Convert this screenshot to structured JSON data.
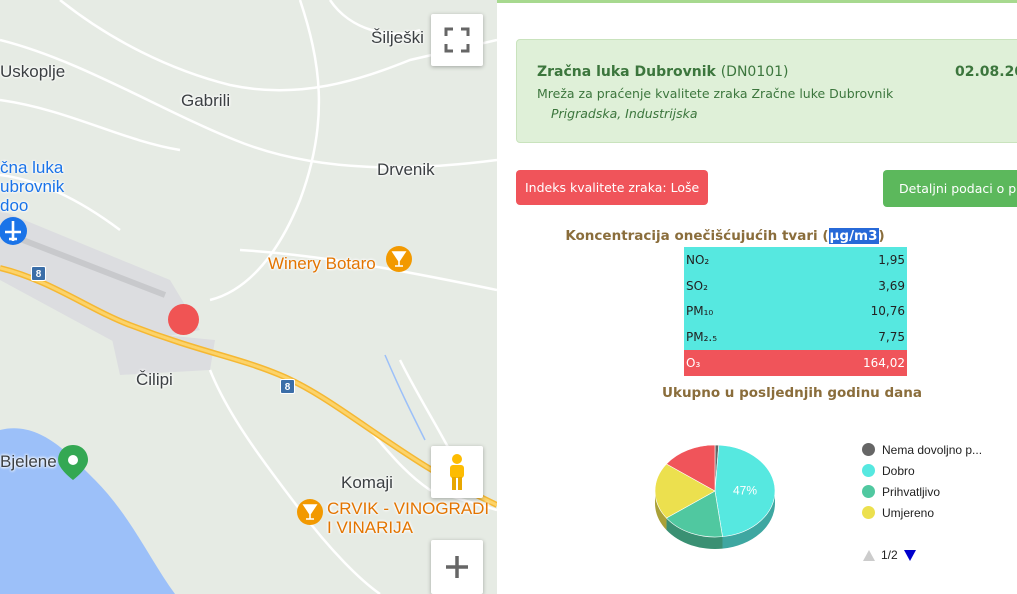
{
  "map": {
    "places": {
      "siljeski": "Šilješki",
      "uskoplje": "Uskoplje",
      "gabrili": "Gabrili",
      "airport_line1": "čna luka",
      "airport_line2": "ubrovnik",
      "airport_line3": "doo",
      "drvenik": "Drvenik",
      "winery": "Winery Botaro",
      "cilipi": "Čilipi",
      "komaji": "Komaji",
      "crvik_line1": "CRVIK - VINOGRADI",
      "crvik_line2": "I VINARIJA",
      "bjelene": "Bjelene"
    },
    "road_shields": [
      "8",
      "8"
    ],
    "icons": {
      "fullscreen": "fullscreen-icon",
      "pegman": "pegman-icon",
      "zoom_in": "plus-icon",
      "airport": "airplane-icon",
      "winery_pin": "wine-glass-icon",
      "park_pin": "location-pin-icon"
    },
    "marker_color": "#f05454"
  },
  "station": {
    "name": "Zračna luka Dubrovnik",
    "code": "(DN0101)",
    "date": "02.08.20",
    "network": "Mreža za praćenje kvalitete zraka Zračne luke Dubrovnik",
    "type": "Prigradska, Industrijska"
  },
  "aqi": {
    "label": "Indeks kvalitete zraka: Loše",
    "color": "#f0545a"
  },
  "details_button": "Detaljni podaci o p",
  "concentration": {
    "title_prefix": "Koncentracija onečišćujućih tvari (",
    "unit": "µg/m3",
    "title_suffix": ")",
    "rows": [
      {
        "name": "NO₂",
        "value": "1,95",
        "color": "#56e8e0"
      },
      {
        "name": "SO₂",
        "value": "3,69",
        "color": "#56e8e0"
      },
      {
        "name": "PM₁₀",
        "value": "10,76",
        "color": "#56e8e0"
      },
      {
        "name": "PM₂.₅",
        "value": "7,75",
        "color": "#56e8e0"
      },
      {
        "name": "O₃",
        "value": "164,02",
        "color": "#f0545a"
      }
    ]
  },
  "year_summary": {
    "title": "Ukupno u posljednjih godinu dana",
    "slice_label": "47%",
    "legend": [
      {
        "label": "Nema dovoljno p...",
        "color": "#666666"
      },
      {
        "label": "Dobro",
        "color": "#56e8e0"
      },
      {
        "label": "Prihvatljivo",
        "color": "#50c8a0"
      },
      {
        "label": "Umjereno",
        "color": "#ece04e"
      }
    ],
    "pager": "1/2"
  },
  "chart_data": {
    "type": "pie",
    "categories": [
      "Nema dovoljno podataka",
      "Dobro",
      "Prihvatljivo",
      "Umjereno",
      "Loše"
    ],
    "values": [
      1,
      47,
      17,
      20,
      15
    ],
    "colors": [
      "#666666",
      "#56e8e0",
      "#50c8a0",
      "#ece04e",
      "#f0545a"
    ],
    "title": "Ukupno u posljednjih godinu dana"
  }
}
